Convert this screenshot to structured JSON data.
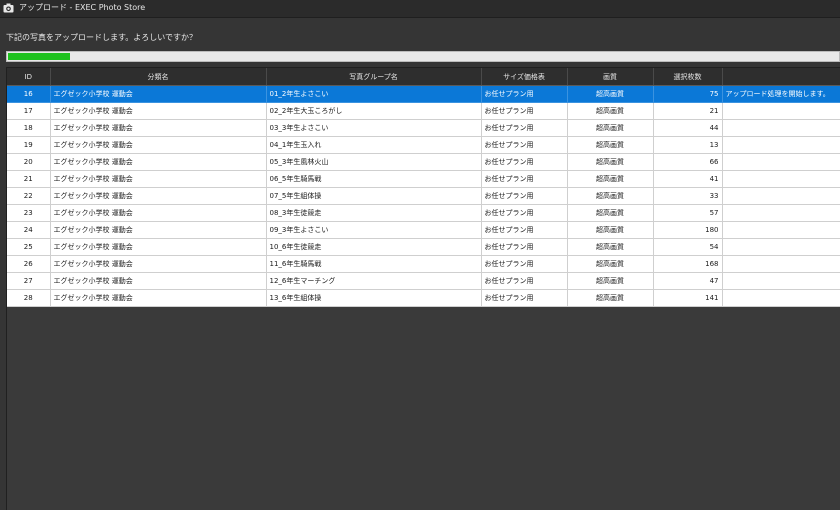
{
  "window": {
    "title": "アップロード - EXEC Photo Store",
    "icon": "camera-icon"
  },
  "prompt_text": "下記の写真をアップロードします。よろしいですか？",
  "upload_progress": {
    "fraction": 0.075,
    "color": "#1fc21f"
  },
  "table": {
    "columns": {
      "id": "ID",
      "category": "分類名",
      "group": "写真グループ名",
      "price_table": "サイズ価格表",
      "quality": "画質",
      "count": "選択枚数",
      "status": ""
    },
    "selected_index": 0,
    "rows": [
      {
        "id": "16",
        "category": "エグゼック小学校 運動会",
        "group": "01_2年生よさこい",
        "price_table": "お任せプラン用",
        "quality": "超高画質",
        "count": "75",
        "status": "アップロード処理を開始します。"
      },
      {
        "id": "17",
        "category": "エグゼック小学校 運動会",
        "group": "02_2年生大玉ころがし",
        "price_table": "お任せプラン用",
        "quality": "超高画質",
        "count": "21",
        "status": ""
      },
      {
        "id": "18",
        "category": "エグゼック小学校 運動会",
        "group": "03_3年生よさこい",
        "price_table": "お任せプラン用",
        "quality": "超高画質",
        "count": "44",
        "status": ""
      },
      {
        "id": "19",
        "category": "エグゼック小学校 運動会",
        "group": "04_1年生玉入れ",
        "price_table": "お任せプラン用",
        "quality": "超高画質",
        "count": "13",
        "status": ""
      },
      {
        "id": "20",
        "category": "エグゼック小学校 運動会",
        "group": "05_3年生風林火山",
        "price_table": "お任せプラン用",
        "quality": "超高画質",
        "count": "66",
        "status": ""
      },
      {
        "id": "21",
        "category": "エグゼック小学校 運動会",
        "group": "06_5年生騎馬戦",
        "price_table": "お任せプラン用",
        "quality": "超高画質",
        "count": "41",
        "status": ""
      },
      {
        "id": "22",
        "category": "エグゼック小学校 運動会",
        "group": "07_5年生組体操",
        "price_table": "お任せプラン用",
        "quality": "超高画質",
        "count": "33",
        "status": ""
      },
      {
        "id": "23",
        "category": "エグゼック小学校 運動会",
        "group": "08_3年生徒競走",
        "price_table": "お任せプラン用",
        "quality": "超高画質",
        "count": "57",
        "status": ""
      },
      {
        "id": "24",
        "category": "エグゼック小学校 運動会",
        "group": "09_3年生よさこい",
        "price_table": "お任せプラン用",
        "quality": "超高画質",
        "count": "180",
        "status": ""
      },
      {
        "id": "25",
        "category": "エグゼック小学校 運動会",
        "group": "10_6年生徒競走",
        "price_table": "お任せプラン用",
        "quality": "超高画質",
        "count": "54",
        "status": ""
      },
      {
        "id": "26",
        "category": "エグゼック小学校 運動会",
        "group": "11_6年生騎馬戦",
        "price_table": "お任せプラン用",
        "quality": "超高画質",
        "count": "168",
        "status": ""
      },
      {
        "id": "27",
        "category": "エグゼック小学校 運動会",
        "group": "12_6年生マーチング",
        "price_table": "お任せプラン用",
        "quality": "超高画質",
        "count": "47",
        "status": ""
      },
      {
        "id": "28",
        "category": "エグゼック小学校 運動会",
        "group": "13_6年生組体操",
        "price_table": "お任せプラン用",
        "quality": "超高画質",
        "count": "141",
        "status": ""
      }
    ]
  }
}
